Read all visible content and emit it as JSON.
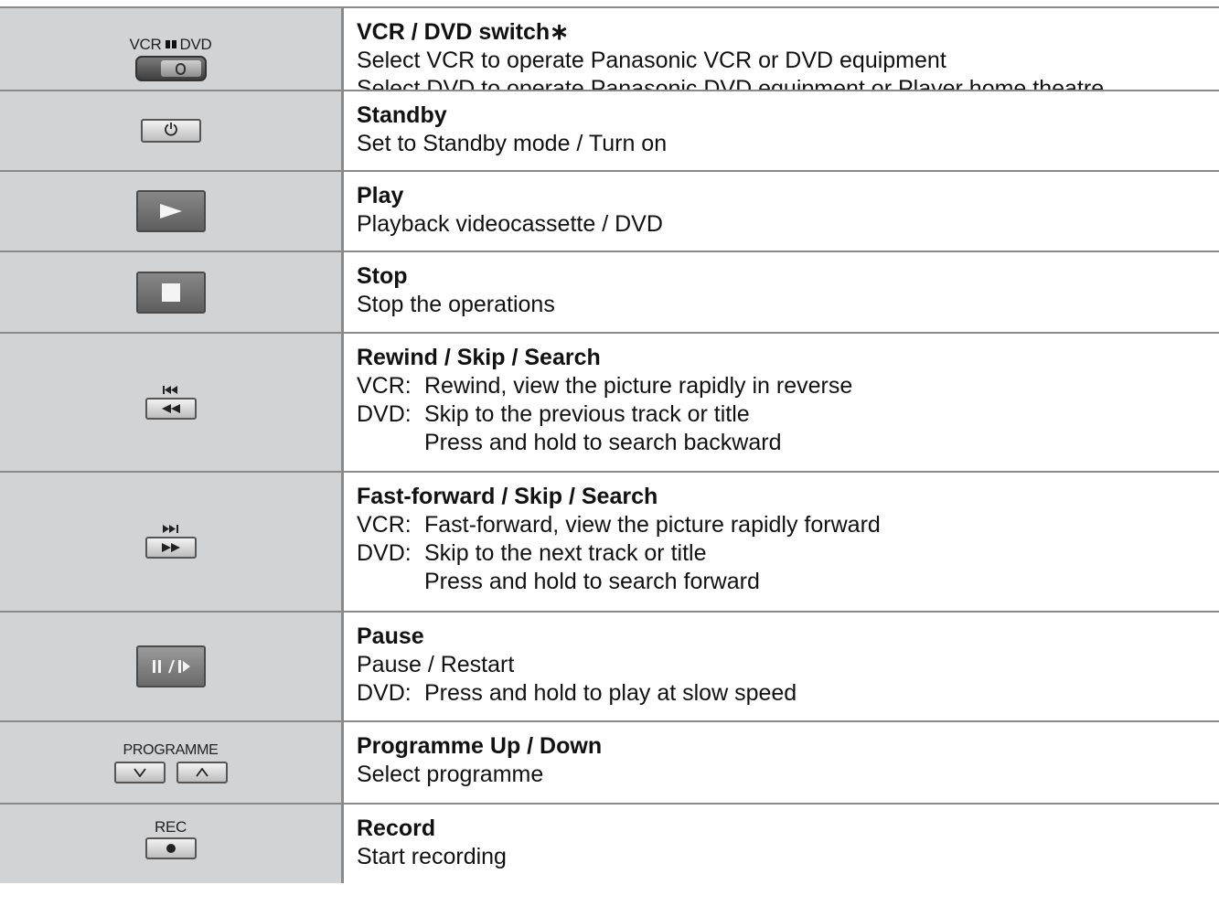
{
  "rows": [
    {
      "icon": {
        "name": "vcr-dvd-switch-icon",
        "label_left": "VCR",
        "label_right": "DVD"
      },
      "title": "VCR / DVD switch∗",
      "lines": [
        "Select VCR to operate Panasonic VCR or DVD equipment",
        "Select DVD to operate Panasonic DVD equipment or Player home theatre"
      ]
    },
    {
      "icon": {
        "name": "standby-power-icon",
        "glyph": "⏻"
      },
      "title": "Standby",
      "lines": [
        "Set to Standby mode / Turn on"
      ]
    },
    {
      "icon": {
        "name": "play-icon"
      },
      "title": "Play",
      "lines": [
        "Playback videocassette / DVD"
      ]
    },
    {
      "icon": {
        "name": "stop-icon"
      },
      "title": "Stop",
      "lines": [
        "Stop the operations"
      ]
    },
    {
      "icon": {
        "name": "rewind-skip-icon",
        "top_glyph": "⏮",
        "btn_glyph": "◀◀"
      },
      "title": "Rewind / Skip / Search",
      "lines": [
        {
          "prefix": "VCR:",
          "text": "Rewind, view the picture rapidly in reverse"
        },
        {
          "prefix": "DVD:",
          "text": "Skip to the previous track or title"
        },
        {
          "prefix": "",
          "text": "Press and hold to search backward"
        }
      ]
    },
    {
      "icon": {
        "name": "fast-forward-skip-icon",
        "top_glyph": "⏭",
        "btn_glyph": "▶▶"
      },
      "title": "Fast-forward / Skip / Search",
      "lines": [
        {
          "prefix": "VCR:",
          "text": "Fast-forward, view the picture rapidly forward"
        },
        {
          "prefix": "DVD:",
          "text": "Skip to the next track or title"
        },
        {
          "prefix": "",
          "text": "Press and hold to search forward"
        }
      ]
    },
    {
      "icon": {
        "name": "pause-slow-icon",
        "glyph": "II/I▸"
      },
      "title": "Pause",
      "lines": [
        "Pause / Restart",
        {
          "prefix": "DVD:",
          "text": "Press and hold to play at slow speed"
        }
      ]
    },
    {
      "icon": {
        "name": "programme-up-down-icon",
        "label": "PROGRAMME",
        "down": "∨",
        "up": "∧"
      },
      "title": "Programme Up / Down",
      "lines": [
        "Select programme"
      ]
    },
    {
      "icon": {
        "name": "record-icon",
        "label": "REC",
        "glyph": "●"
      },
      "title": "Record",
      "lines": [
        "Start recording"
      ]
    }
  ]
}
